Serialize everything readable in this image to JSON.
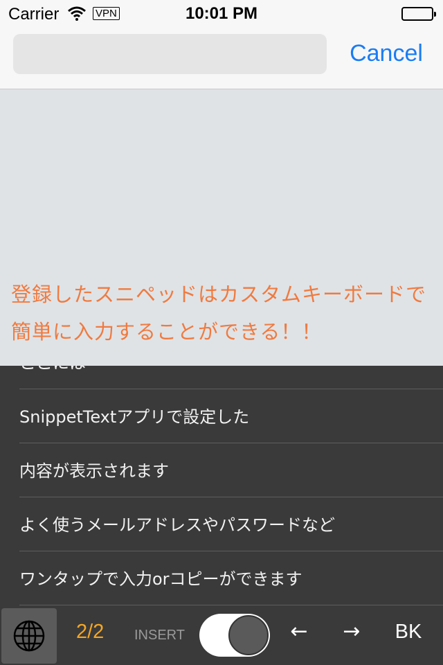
{
  "status_bar": {
    "carrier": "Carrier",
    "vpn": "VPN",
    "time": "10:01 PM"
  },
  "search": {
    "value": "",
    "placeholder": "",
    "cancel_label": "Cancel"
  },
  "promo": {
    "line1": "登録したスニペッドはカスタムキーボードで",
    "line2": "簡単に入力することができる！！"
  },
  "snippets": [
    "ここには",
    "SnippetTextアプリで設定した",
    "内容が表示されます",
    "よく使うメールアドレスやパスワードなど",
    "ワンタップで入力orコピーができます"
  ],
  "toolbar": {
    "globe_icon": "globe-icon",
    "page_indicator": "2/2",
    "insert_label": "INSERT",
    "insert_toggle_on": true,
    "left_arrow": "←",
    "right_arrow": "→",
    "backspace_label": "BK"
  },
  "colors": {
    "accent_blue": "#1a7cf5",
    "promo_orange": "#f07a3f",
    "page_indicator_orange": "#f5a623",
    "keyboard_bg": "#3a3a3a"
  }
}
